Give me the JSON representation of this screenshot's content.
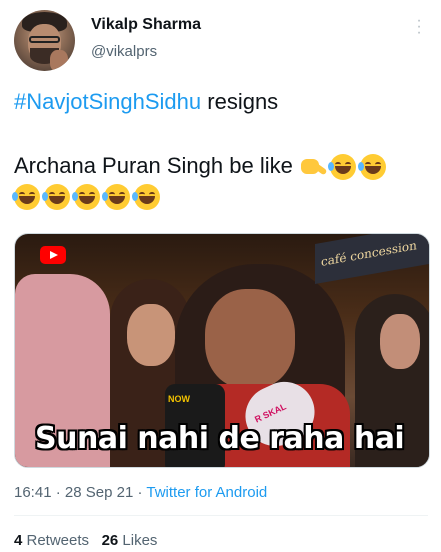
{
  "author": {
    "name": "Vikalp Sharma",
    "handle": "@vikalprs"
  },
  "tweet": {
    "hashtag": "#NavjotSinghSidhu",
    "line1_rest": " resigns",
    "line2_text": "Archana Puran Singh be like ",
    "emojis": [
      "pointing-down-hand",
      "grinning-sweat-face",
      "grinning-sweat-face",
      "grinning-sweat-face",
      "grinning-sweat-face",
      "grinning-sweat-face",
      "grinning-sweat-face",
      "grinning-sweat-face"
    ]
  },
  "media": {
    "caption": "Sunai nahi de raha hai",
    "sign_text": "café concession",
    "mic_labels": [
      "NOW",
      "R SKAL"
    ]
  },
  "meta": {
    "time": "16:41",
    "separator1": " · ",
    "date": "28 Sep 21",
    "separator2": " · ",
    "source": "Twitter for Android"
  },
  "stats": {
    "retweets_count": "4",
    "retweets_label": " Retweets",
    "likes_count": "26",
    "likes_label": " Likes"
  },
  "colors": {
    "link": "#1d9bf0",
    "secondary_text": "#536471",
    "primary_text": "#0f1419"
  }
}
